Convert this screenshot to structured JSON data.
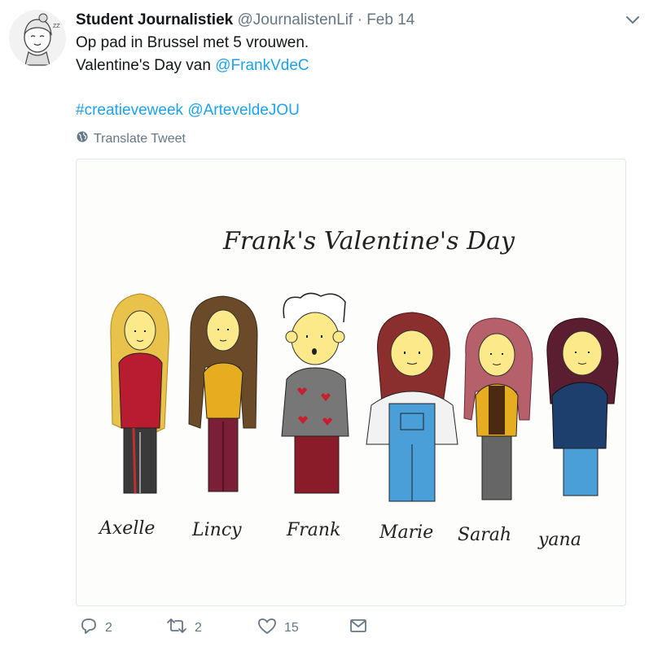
{
  "tweet": {
    "author_name": "Student Journalistiek",
    "handle": "@JournalistenLif",
    "separator": "·",
    "date": "Feb 14",
    "line1": "Op pad in Brussel met 5 vrouwen.",
    "line2_prefix": "Valentine's Day van ",
    "mention1": "@FrankVdeC",
    "hashtag": "#creatieveweek",
    "mention2": "@ArteveldeJOU",
    "translate_label": "Translate Tweet"
  },
  "drawing": {
    "title": "Frank's Valentine's Day",
    "names": [
      "Axelle",
      "Lincy",
      "Frank",
      "Marie",
      "Sarah",
      "yana"
    ]
  },
  "actions": {
    "reply_count": "2",
    "retweet_count": "2",
    "like_count": "15"
  },
  "colors": {
    "link": "#1da1f2",
    "secondary": "#657786"
  },
  "icons": [
    "avatar",
    "chevron-down-icon",
    "globe-icon",
    "reply-icon",
    "retweet-icon",
    "heart-icon",
    "mail-icon"
  ]
}
